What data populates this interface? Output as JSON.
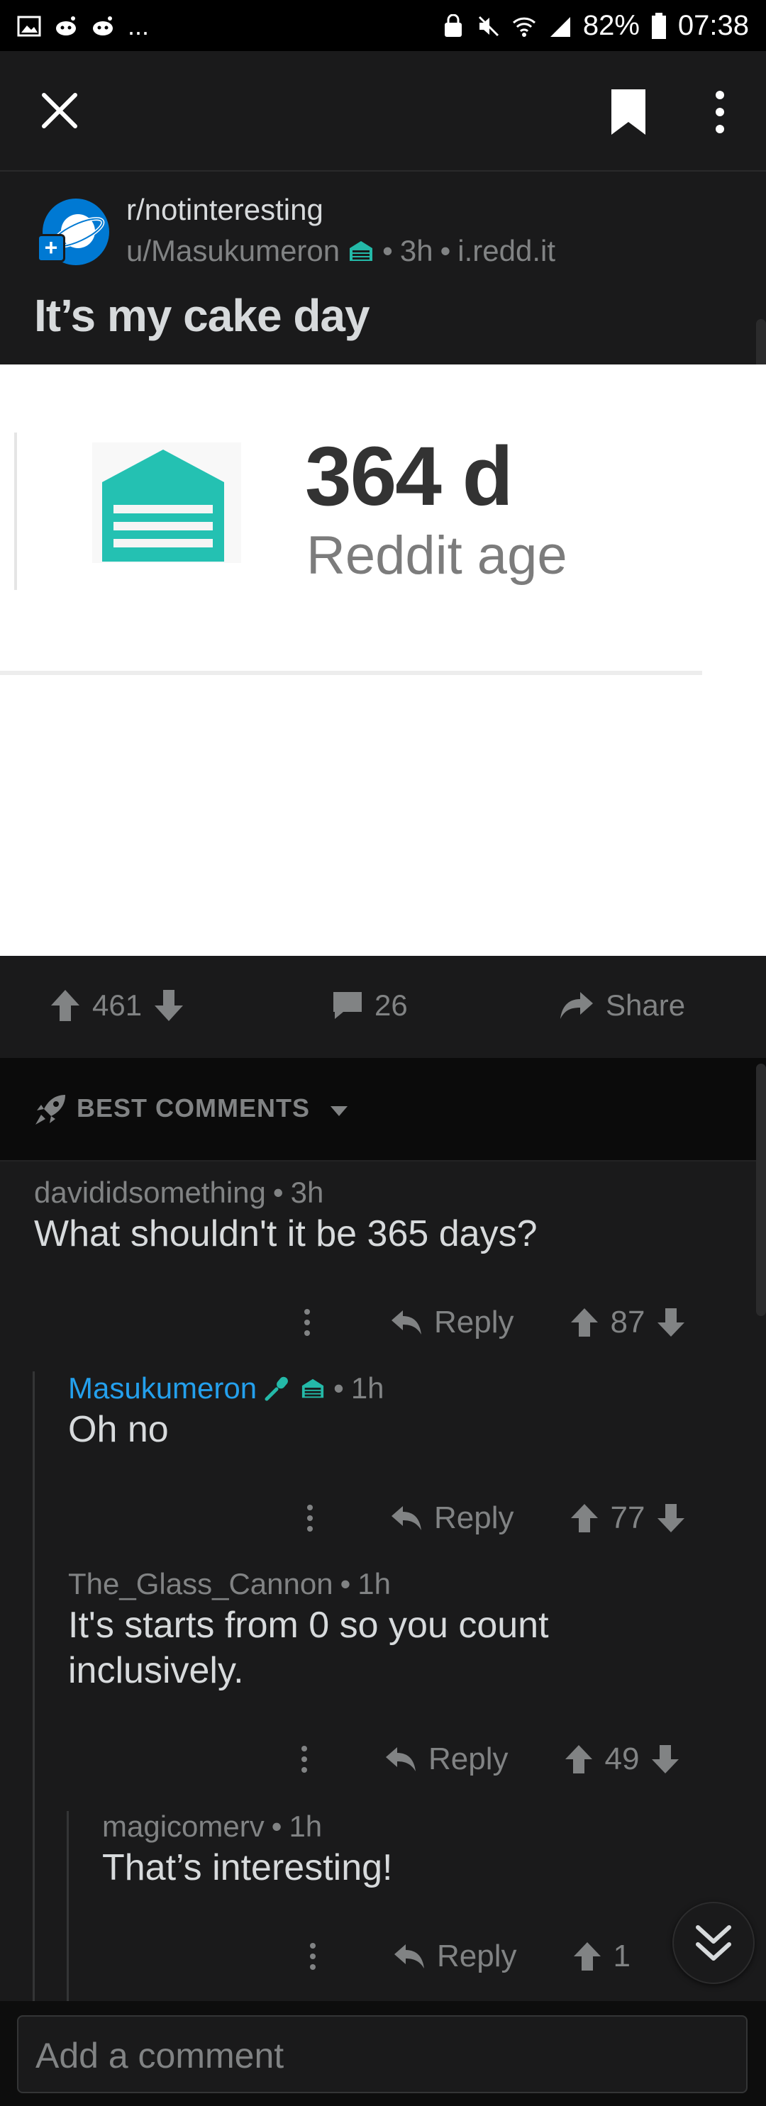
{
  "status_bar": {
    "battery": "82%",
    "time": "07:38",
    "ellipsis": "..."
  },
  "subreddit": {
    "name": "r/notinteresting"
  },
  "post": {
    "author": "u/Masukumeron",
    "age": "3h",
    "domain": "i.redd.it",
    "separator": "•",
    "title": "It’s my cake day",
    "image": {
      "value": "364 d",
      "label": "Reddit age"
    },
    "score": "461",
    "comments": "26",
    "share": "Share"
  },
  "sort": {
    "label": "BEST COMMENTS"
  },
  "comments": [
    {
      "author": "davididsomething",
      "age": "3h",
      "body": "What shouldn't it be 365 days?",
      "reply": "Reply",
      "score": "87"
    },
    {
      "author": "Masukumeron",
      "age": "1h",
      "body": "Oh no",
      "reply": "Reply",
      "score": "77"
    },
    {
      "author": "The_Glass_Cannon",
      "age": "1h",
      "body": "It's starts from 0 so you count inclusively.",
      "reply": "Reply",
      "score": "49"
    },
    {
      "author": "magicomerv",
      "age": "1h",
      "body": "That’s interesting!",
      "reply": "Reply",
      "score": "1"
    }
  ],
  "composer": {
    "placeholder": "Add a comment"
  },
  "colors": {
    "op_blue": "#24a0ed",
    "teal": "#24b9a8",
    "accent_blue": "#0079d3"
  }
}
